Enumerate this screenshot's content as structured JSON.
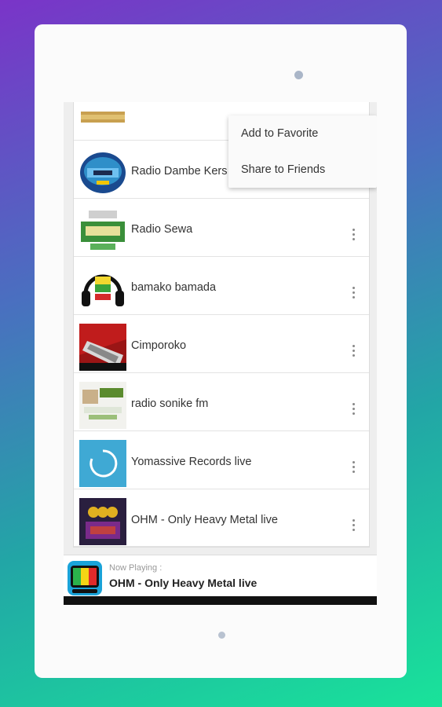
{
  "stations": [
    {
      "name": "",
      "thumb_colors": [
        "#c8a050",
        "#e0c070"
      ]
    },
    {
      "name": "Radio Dambe Kers",
      "thumb_colors": [
        "#2f8fc9",
        "#1a4a8f"
      ]
    },
    {
      "name": "Radio Sewa",
      "thumb_colors": [
        "#3a8f3a",
        "#e7e09a"
      ]
    },
    {
      "name": "bamako bamada",
      "thumb_colors": [
        "#111111",
        "#f2d82f"
      ]
    },
    {
      "name": "Cimporoko",
      "thumb_colors": [
        "#b01a1a",
        "#c0c0c0"
      ]
    },
    {
      "name": "radio sonike fm",
      "thumb_colors": [
        "#dfe6d8",
        "#5b8b2e"
      ]
    },
    {
      "name": "Yomassive Records live",
      "thumb_colors": [
        "#3fa9d4",
        "#ffffff"
      ]
    },
    {
      "name": "OHM - Only Heavy Metal live",
      "thumb_colors": [
        "#3a2a5a",
        "#c04040"
      ]
    }
  ],
  "menu": {
    "add_favorite": "Add to Favorite",
    "share_friends": "Share to Friends"
  },
  "now_playing": {
    "label": "Now Playing :",
    "title": "OHM - Only Heavy Metal live"
  },
  "icons": {
    "more": "more-vert-icon",
    "app": "radio-app-icon"
  },
  "colors": {
    "background_top": "#7a34c8",
    "background_bottom": "#19e39a"
  }
}
